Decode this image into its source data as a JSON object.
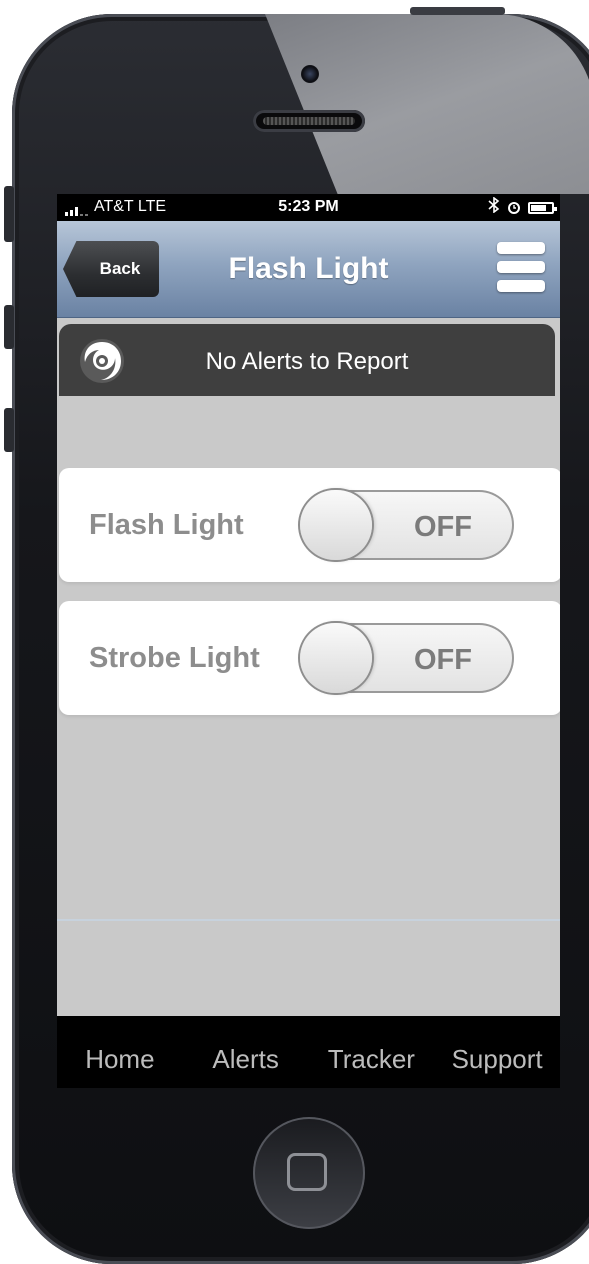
{
  "status_bar": {
    "carrier": "AT&T LTE",
    "time": "5:23 PM",
    "bluetooth_icon": "bluetooth-icon",
    "alarm_icon": "alarm-clock-icon",
    "battery_icon": "battery-icon"
  },
  "nav": {
    "back_label": "Back",
    "title": "Flash Light",
    "menu_icon": "hamburger-menu-icon"
  },
  "alert": {
    "icon": "storm-swirl-icon",
    "text": "No Alerts to Report"
  },
  "settings": [
    {
      "label": "Flash Light",
      "state": "OFF"
    },
    {
      "label": "Strobe Light",
      "state": "OFF"
    }
  ],
  "tabs": [
    "Home",
    "Alerts",
    "Tracker",
    "Support"
  ],
  "colors": {
    "nav_gradient_top": "#b7c6d8",
    "nav_gradient_bottom": "#6a82a3",
    "alert_bar": "#3f3f3f",
    "screen_background": "#c9c9c9",
    "tab_bar": "#000000"
  }
}
